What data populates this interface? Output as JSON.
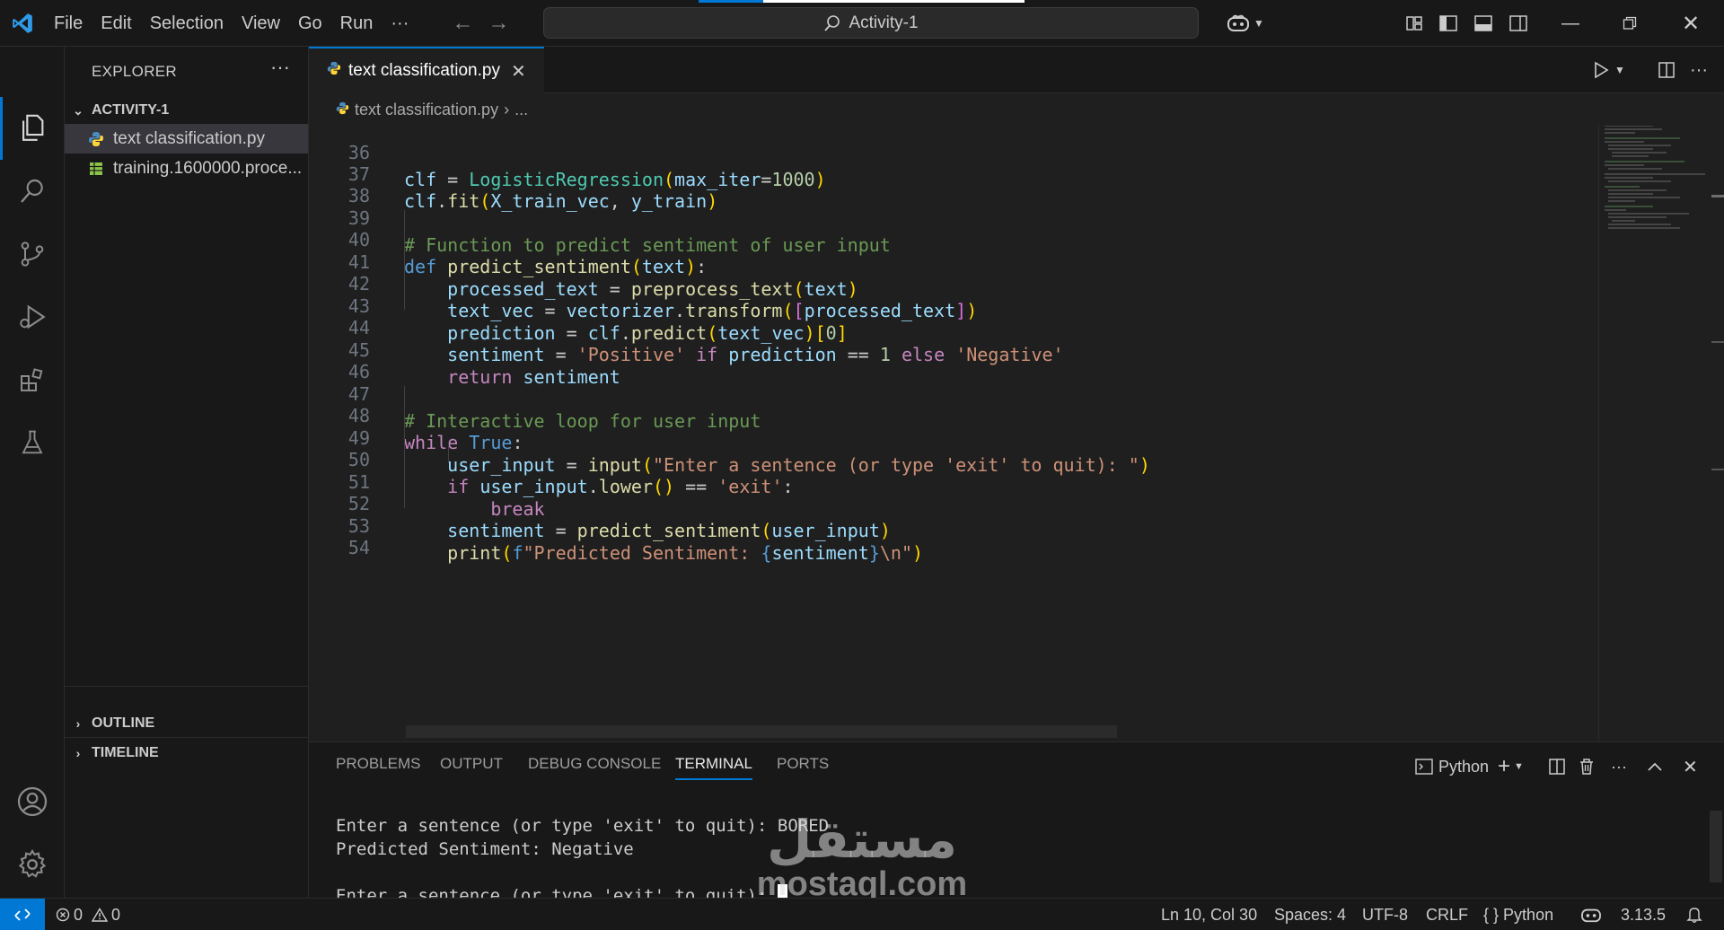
{
  "titlebar": {
    "menu": [
      "File",
      "Edit",
      "Selection",
      "View",
      "Go",
      "Run"
    ],
    "more": "···",
    "search_text": "Activity-1"
  },
  "sidebar": {
    "title": "EXPLORER",
    "more": "···",
    "folder": "ACTIVITY-1",
    "files": [
      {
        "name": "text classification.py",
        "icon": "python-file-icon"
      },
      {
        "name": "training.1600000.proce...",
        "icon": "csv-file-icon"
      }
    ],
    "outline": "OUTLINE",
    "timeline": "TIMELINE"
  },
  "editor": {
    "tab_label": "text classification.py",
    "breadcrumb_file": "text classification.py",
    "breadcrumb_more": "...",
    "line_numbers": [
      "36",
      "37",
      "38",
      "39",
      "40",
      "41",
      "42",
      "43",
      "44",
      "45",
      "46",
      "47",
      "48",
      "49",
      "50",
      "51",
      "52",
      "53",
      "54"
    ],
    "code_lines": [
      "clf = LogisticRegression(max_iter=1000)",
      "clf.fit(X_train_vec, y_train)",
      "",
      "# Function to predict sentiment of user input",
      "def predict_sentiment(text):",
      "    processed_text = preprocess_text(text)",
      "    text_vec = vectorizer.transform([processed_text])",
      "    prediction = clf.predict(text_vec)[0]",
      "    sentiment = 'Positive' if prediction == 1 else 'Negative'",
      "    return sentiment",
      "",
      "# Interactive loop for user input",
      "while True:",
      "    user_input = input(\"Enter a sentence (or type 'exit' to quit): \")",
      "    if user_input.lower() == 'exit':",
      "        break",
      "    sentiment = predict_sentiment(user_input)",
      "    print(f\"Predicted Sentiment: {sentiment}\\n\")",
      ""
    ]
  },
  "panel": {
    "tabs": [
      "PROBLEMS",
      "OUTPUT",
      "DEBUG CONSOLE",
      "TERMINAL",
      "PORTS"
    ],
    "active_tab": "TERMINAL",
    "terminal_profile": "Python",
    "terminal_lines": [
      "Enter a sentence (or type 'exit' to quit): BORED",
      "Predicted Sentiment: Negative",
      "",
      "Enter a sentence (or type 'exit' to quit): "
    ]
  },
  "watermark": {
    "arabic": "مستقل",
    "latin": "mostaql.com"
  },
  "statusbar": {
    "errors": "0",
    "warnings": "0",
    "position": "Ln 10, Col 30",
    "spaces": "Spaces: 4",
    "encoding": "UTF-8",
    "eol": "CRLF",
    "language": "Python",
    "python_version": "3.13.5"
  },
  "colors": {
    "accent": "#0078d4",
    "background": "#1f1f1f",
    "chrome": "#181818"
  }
}
